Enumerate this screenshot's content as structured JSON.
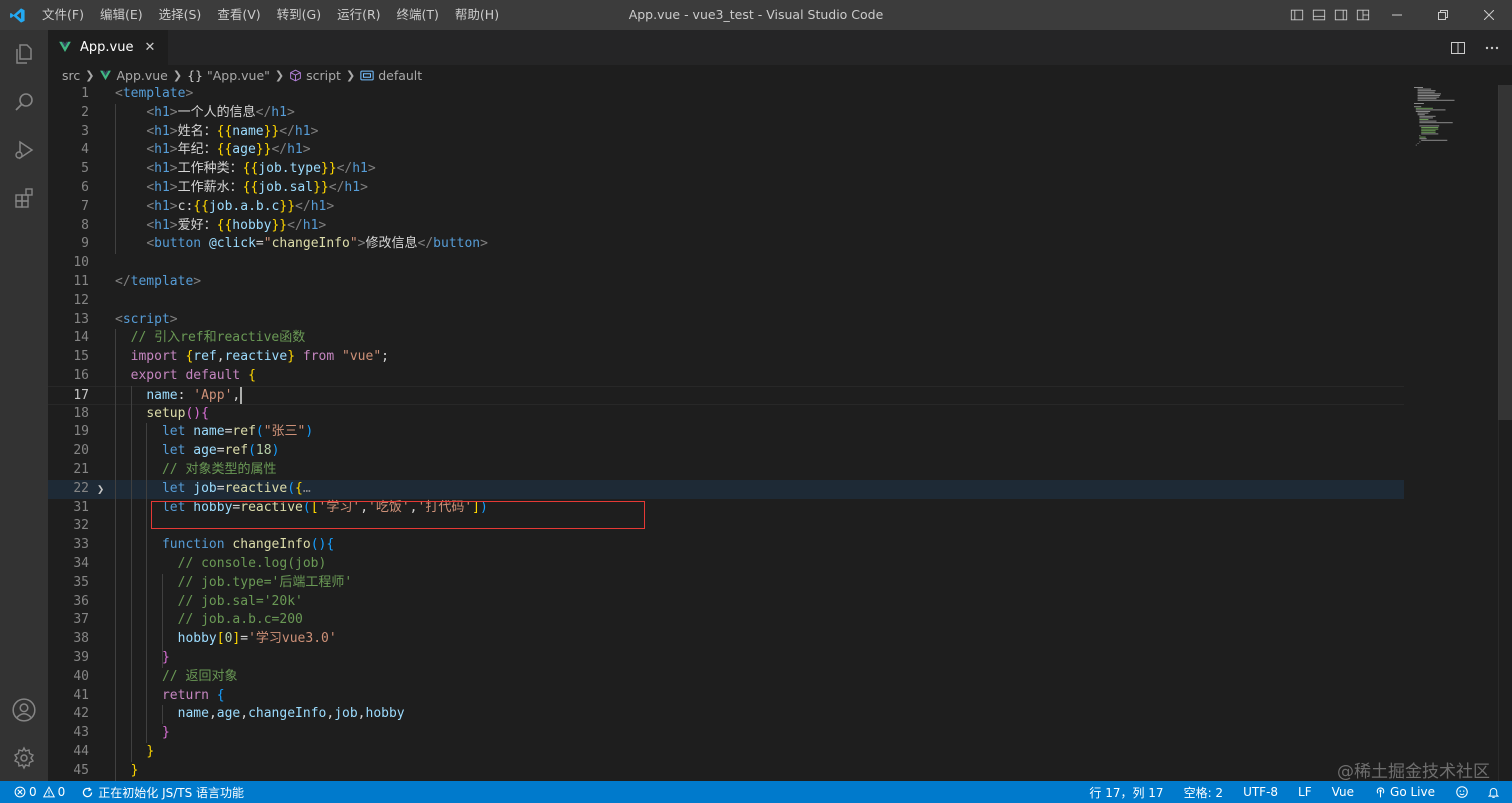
{
  "window": {
    "title": "App.vue - vue3_test - Visual Studio Code",
    "menu": [
      "文件(F)",
      "编辑(E)",
      "选择(S)",
      "查看(V)",
      "转到(G)",
      "运行(R)",
      "终端(T)",
      "帮助(H)"
    ]
  },
  "tab": {
    "label": "App.vue",
    "close": "✕"
  },
  "breadcrumb": {
    "folder": "src",
    "file": "App.vue",
    "object": "\"App.vue\"",
    "script": "script",
    "default": "default"
  },
  "editor": {
    "current_line": 17,
    "lines": [
      {
        "n": 1,
        "text": "<template>"
      },
      {
        "n": 2,
        "text": "    <h1>一个人的信息</h1>"
      },
      {
        "n": 3,
        "text": "    <h1>姓名：{{name}}</h1>"
      },
      {
        "n": 4,
        "text": "    <h1>年纪：{{age}}</h1>"
      },
      {
        "n": 5,
        "text": "    <h1>工作种类：{{job.type}}</h1>"
      },
      {
        "n": 6,
        "text": "    <h1>工作薪水：{{job.sal}}</h1>"
      },
      {
        "n": 7,
        "text": "    <h1>c:{{job.a.b.c}}</h1>"
      },
      {
        "n": 8,
        "text": "    <h1>爱好：{{hobby}}</h1>"
      },
      {
        "n": 9,
        "text": "    <button @click=\"changeInfo\">修改信息</button>"
      },
      {
        "n": 10,
        "text": ""
      },
      {
        "n": 11,
        "text": "</template>"
      },
      {
        "n": 12,
        "text": ""
      },
      {
        "n": 13,
        "text": "<script>"
      },
      {
        "n": 14,
        "text": "  // 引入ref和reactive函数"
      },
      {
        "n": 15,
        "text": "  import {ref,reactive} from \"vue\";"
      },
      {
        "n": 16,
        "text": "  export default {"
      },
      {
        "n": 17,
        "text": "    name: 'App',"
      },
      {
        "n": 18,
        "text": "    setup(){"
      },
      {
        "n": 19,
        "text": "      let name=ref(\"张三\")"
      },
      {
        "n": 20,
        "text": "      let age=ref(18)"
      },
      {
        "n": 21,
        "text": "      // 对象类型的属性"
      },
      {
        "n": 22,
        "text": "      let job=reactive({…"
      },
      {
        "n": 31,
        "text": "      let hobby=reactive(['学习','吃饭','打代码'])"
      },
      {
        "n": 32,
        "text": ""
      },
      {
        "n": 33,
        "text": "      function changeInfo(){"
      },
      {
        "n": 34,
        "text": "        // console.log(job)"
      },
      {
        "n": 35,
        "text": "        // job.type='后端工程师'"
      },
      {
        "n": 36,
        "text": "        // job.sal='20k'"
      },
      {
        "n": 37,
        "text": "        // job.a.b.c=200"
      },
      {
        "n": 38,
        "text": "        hobby[0]='学习vue3.0'"
      },
      {
        "n": 39,
        "text": "      }"
      },
      {
        "n": 40,
        "text": "      // 返回对象"
      },
      {
        "n": 41,
        "text": "      return {"
      },
      {
        "n": 42,
        "text": "        name,age,changeInfo,job,hobby"
      },
      {
        "n": 43,
        "text": "      }"
      },
      {
        "n": 44,
        "text": "    }"
      },
      {
        "n": 45,
        "text": "  }"
      }
    ]
  },
  "statusbar": {
    "errors": "0",
    "warnings": "0",
    "init_message": "正在初始化 JS/TS 语言功能",
    "position": "行 17，列 17",
    "spaces": "空格: 2",
    "encoding": "UTF-8",
    "eol": "LF",
    "language": "Vue",
    "golive": "Go Live"
  },
  "watermark": "@稀土掘金技术社区",
  "colors": {
    "statusbar": "#007acc",
    "titlebar": "#3c3c3c",
    "activitybar": "#333333",
    "editor": "#1e1e1e",
    "highlight_box": "#e53935"
  },
  "icons": [
    "vscode-logo-icon",
    "explorer-icon",
    "search-icon",
    "run-debug-icon",
    "extensions-icon",
    "account-icon",
    "settings-gear-icon",
    "split-editor-icon",
    "more-actions-icon",
    "vue-file-icon",
    "error-icon",
    "warning-icon",
    "sync-icon",
    "broadcast-icon",
    "bell-icon",
    "feedback-icon"
  ]
}
